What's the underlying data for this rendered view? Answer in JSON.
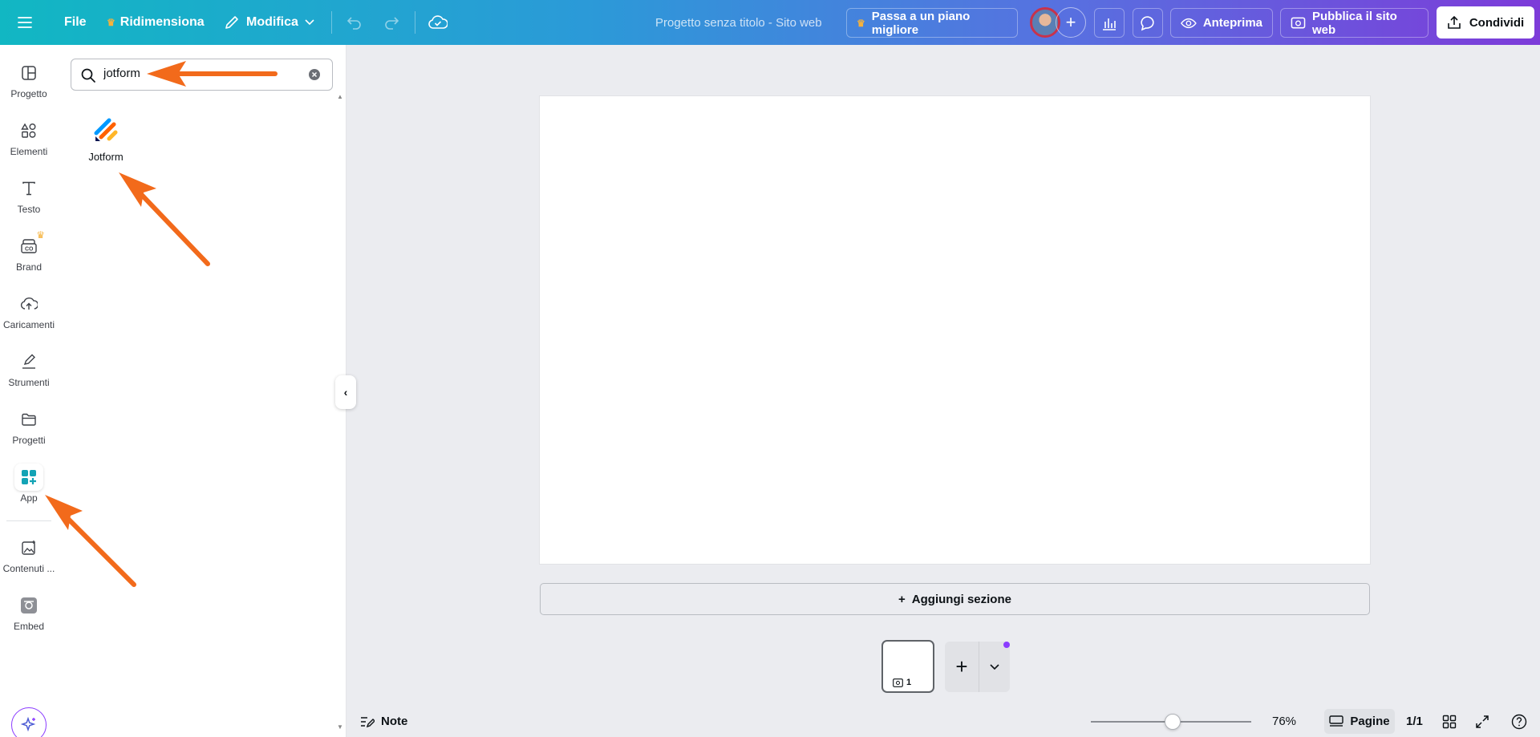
{
  "topbar": {
    "file_label": "File",
    "resize_label": "Ridimensiona",
    "edit_label": "Modifica",
    "project_title": "Progetto senza titolo - Sito web",
    "upgrade_label": "Passa a un piano migliore",
    "preview_label": "Anteprima",
    "publish_label": "Pubblica il sito web",
    "share_label": "Condividi"
  },
  "rail": {
    "items": [
      {
        "label": "Progetto",
        "icon": "layout-icon"
      },
      {
        "label": "Elementi",
        "icon": "shapes-icon"
      },
      {
        "label": "Testo",
        "icon": "text-icon"
      },
      {
        "label": "Brand",
        "icon": "brand-icon"
      },
      {
        "label": "Caricamenti",
        "icon": "cloud-upload-icon"
      },
      {
        "label": "Strumenti",
        "icon": "pen-icon"
      },
      {
        "label": "Progetti",
        "icon": "folder-icon"
      },
      {
        "label": "App",
        "icon": "apps-icon"
      },
      {
        "label": "Contenuti ...",
        "icon": "image-sparkle-icon"
      },
      {
        "label": "Embed",
        "icon": "embed-icon"
      }
    ]
  },
  "panel": {
    "search_value": "jotform",
    "results": [
      {
        "label": "Jotform",
        "icon": "jotform-logo-icon"
      }
    ]
  },
  "canvas": {
    "add_section_label": "Aggiungi sezione",
    "page_number": "1"
  },
  "bottombar": {
    "notes_label": "Note",
    "zoom": "76%",
    "pages_label": "Pagine",
    "page_count": "1/1"
  },
  "colors": {
    "accent": "#8b3dff",
    "annotation_arrow": "#f26a1b"
  }
}
